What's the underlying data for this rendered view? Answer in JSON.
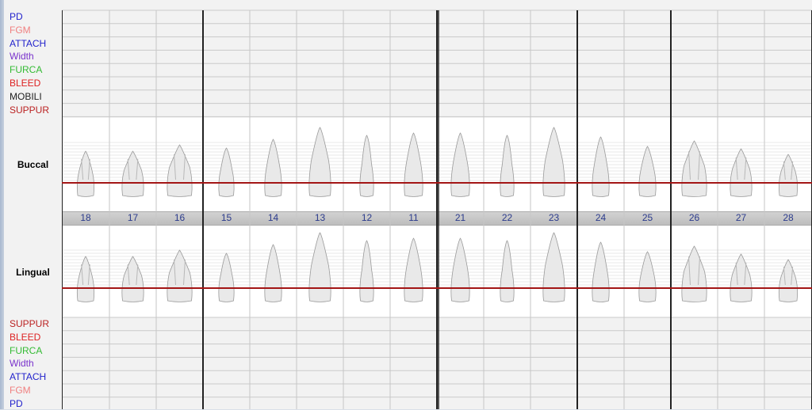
{
  "upper_rows": [
    {
      "label": "PD",
      "color": "#2222cc"
    },
    {
      "label": "FGM",
      "color": "#f08080"
    },
    {
      "label": "ATTACH",
      "color": "#2222cc"
    },
    {
      "label": "Width",
      "color": "#7a33cc"
    },
    {
      "label": "FURCA",
      "color": "#33bb33"
    },
    {
      "label": "BLEED",
      "color": "#dd2222"
    },
    {
      "label": "MOBILI",
      "color": "#222222"
    },
    {
      "label": "SUPPUR",
      "color": "#bb2222"
    }
  ],
  "lower_rows": [
    {
      "label": "SUPPUR",
      "color": "#bb2222"
    },
    {
      "label": "BLEED",
      "color": "#dd2222"
    },
    {
      "label": "FURCA",
      "color": "#33bb33"
    },
    {
      "label": "Width",
      "color": "#7a33cc"
    },
    {
      "label": "ATTACH",
      "color": "#2222cc"
    },
    {
      "label": "FGM",
      "color": "#f08080"
    },
    {
      "label": "PD",
      "color": "#2222cc"
    }
  ],
  "sections": {
    "buccal": "Buccal",
    "lingual": "Lingual"
  },
  "teeth": [
    "18",
    "17",
    "16",
    "15",
    "14",
    "13",
    "12",
    "11",
    "21",
    "22",
    "23",
    "24",
    "25",
    "26",
    "27",
    "28"
  ],
  "colors": {
    "gum_line": "#a31515",
    "tooth_number": "#2b3b8c"
  }
}
